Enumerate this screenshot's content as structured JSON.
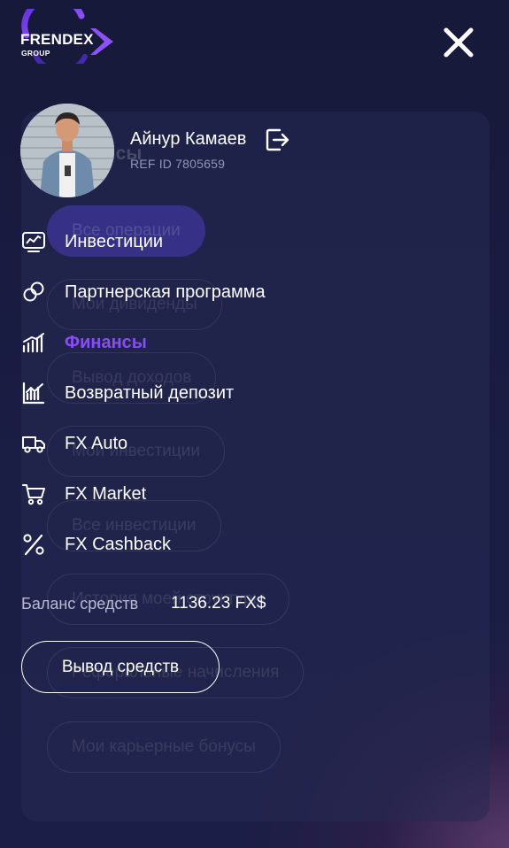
{
  "brand": {
    "name": "FRENDEX",
    "sub": "GROUP",
    "accent": "#8a4df5"
  },
  "user": {
    "name": "Айнур Камаев",
    "ref_id": "REF ID 7805659"
  },
  "menu": {
    "items": [
      {
        "label": "Инвестиции",
        "icon": "monitor-chart-icon",
        "active": false
      },
      {
        "label": "Партнерская программа",
        "icon": "link-rings-icon",
        "active": false
      },
      {
        "label": "Финансы",
        "icon": "bar-growth-icon",
        "active": true
      },
      {
        "label": "Возвратный депозит",
        "icon": "chart-trend-icon",
        "active": false
      },
      {
        "label": "FX Auto",
        "icon": "truck-icon",
        "active": false
      },
      {
        "label": "FX Market",
        "icon": "cart-icon",
        "active": false
      },
      {
        "label": "FX Cashback",
        "icon": "percent-icon",
        "active": false
      }
    ]
  },
  "balance": {
    "label": "Баланс средств",
    "value": "1136.23 FX$"
  },
  "withdraw_label": "Вывод средств",
  "background_page": {
    "heading": "нсы",
    "pills": [
      "Все операции",
      "Мои дивиденды",
      "Вывод доходов",
      "Мои инвестиции",
      "Все инвестиции",
      "История моей структуры",
      "Реферальные начисления",
      "Мои карьерные бонусы"
    ]
  }
}
